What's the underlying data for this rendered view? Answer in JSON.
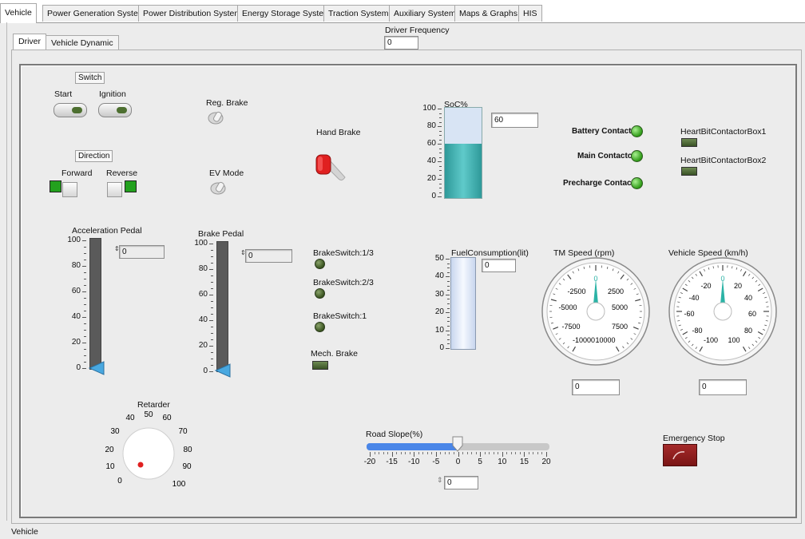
{
  "tabs": [
    "Vehicle",
    "Power Generation System",
    "Power Distribution System",
    "Energy Storage System",
    "Traction System",
    "Auxiliary System",
    "Maps & Graphs",
    "HIS"
  ],
  "subtabs": [
    "Driver",
    "Vehicle Dynamic"
  ],
  "driver_frequency": {
    "label": "Driver Frequency",
    "value": "0"
  },
  "switch_group": {
    "title": "Switch",
    "start": "Start",
    "ignition": "Ignition"
  },
  "direction_group": {
    "title": "Direction",
    "forward": "Forward",
    "reverse": "Reverse"
  },
  "reg_brake": "Reg. Brake",
  "ev_mode": "EV Mode",
  "hand_brake": "Hand Brake",
  "soc": {
    "label": "SoC%",
    "value": "60",
    "level": 60,
    "ticks": [
      "100",
      "80",
      "60",
      "40",
      "20",
      "0"
    ]
  },
  "contactors": {
    "battery": "Battery Contactor",
    "main": "Main Contactor",
    "precharge": "Precharge Contactor"
  },
  "heartbit": {
    "box1": "HeartBitContactorBox1",
    "box2": "HeartBitContactorBox2"
  },
  "accel_pedal": {
    "label": "Acceleration Pedal",
    "value": "0",
    "ticks": [
      "100",
      "80",
      "60",
      "40",
      "20",
      "0"
    ]
  },
  "brake_pedal": {
    "label": "Brake Pedal",
    "value": "0",
    "ticks": [
      "100",
      "80",
      "60",
      "40",
      "20",
      "0"
    ]
  },
  "brake_switches": {
    "s13": "BrakeSwitch:1/3",
    "s23": "BrakeSwitch:2/3",
    "s1": "BrakeSwitch:1",
    "mech": "Mech. Brake"
  },
  "fuel": {
    "label": "FuelConsumption(lit)",
    "value": "0",
    "ticks": [
      "50",
      "40",
      "30",
      "20",
      "10",
      "0"
    ]
  },
  "tm_speed": {
    "label": "TM Speed (rpm)",
    "value": "0",
    "scale": [
      "0",
      "2500",
      "5000",
      "7500",
      "10000",
      "-10000",
      "-7500",
      "-5000",
      "-2500"
    ]
  },
  "vehicle_speed": {
    "label": "Vehicle Speed (km/h)",
    "value": "0",
    "scale": [
      "0",
      "20",
      "40",
      "60",
      "80",
      "100",
      "-100",
      "-80",
      "-60",
      "-40",
      "-20"
    ]
  },
  "retarder": {
    "label": "Retarder",
    "scale": [
      "0",
      "10",
      "20",
      "30",
      "40",
      "50",
      "60",
      "70",
      "80",
      "90",
      "100"
    ]
  },
  "road_slope": {
    "label": "Road Slope(%)",
    "value": "0",
    "ticks": [
      "-20",
      "-15",
      "-10",
      "-5",
      "0",
      "5",
      "10",
      "15",
      "20"
    ]
  },
  "emergency_stop": "Emergency Stop",
  "status_bar": "Vehicle",
  "colors": {
    "tank_fill": "#3aa8a8",
    "led_on": "#2f9a17",
    "pointer": "#2bb3a6",
    "emergency": "#8f1e1e",
    "slider_fill": "#4a86e8"
  }
}
